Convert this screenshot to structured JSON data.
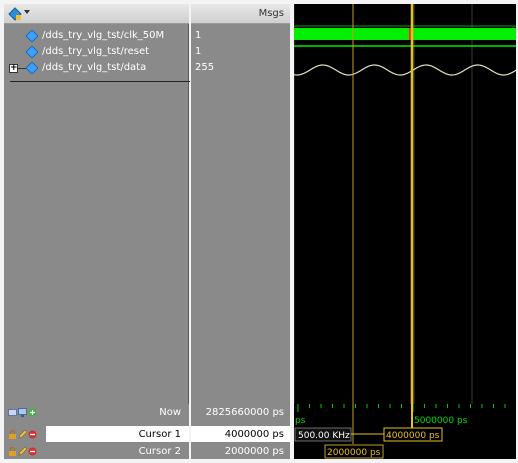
{
  "names_pane": {
    "signals": [
      {
        "name": "/dds_try_vlg_tst/clk_50M"
      },
      {
        "name": "/dds_try_vlg_tst/reset"
      },
      {
        "name": "/dds_try_vlg_tst/data"
      }
    ]
  },
  "values_pane": {
    "header": "Msgs",
    "values": [
      "1",
      "1",
      "255"
    ]
  },
  "wave_pane": {
    "signal_color": "#00ee00",
    "analog_color": "#d8e8c0",
    "cursor_color": "#e8c020",
    "cursor_tick_color": "#ff2020"
  },
  "bottom": {
    "now_label": "Now",
    "now_value": "2825660000 ps",
    "cursor1_label": "Cursor 1",
    "cursor1_value": "4000000 ps",
    "cursor2_label": "Cursor 2",
    "cursor2_value": "2000000 ps",
    "ruler_left_label": "ps",
    "ruler_right_label": "5000000 ps",
    "frequency_label": "500.00 KHz",
    "cursor1_marker": "4000000 ps",
    "cursor2_marker": "2000000 ps"
  }
}
